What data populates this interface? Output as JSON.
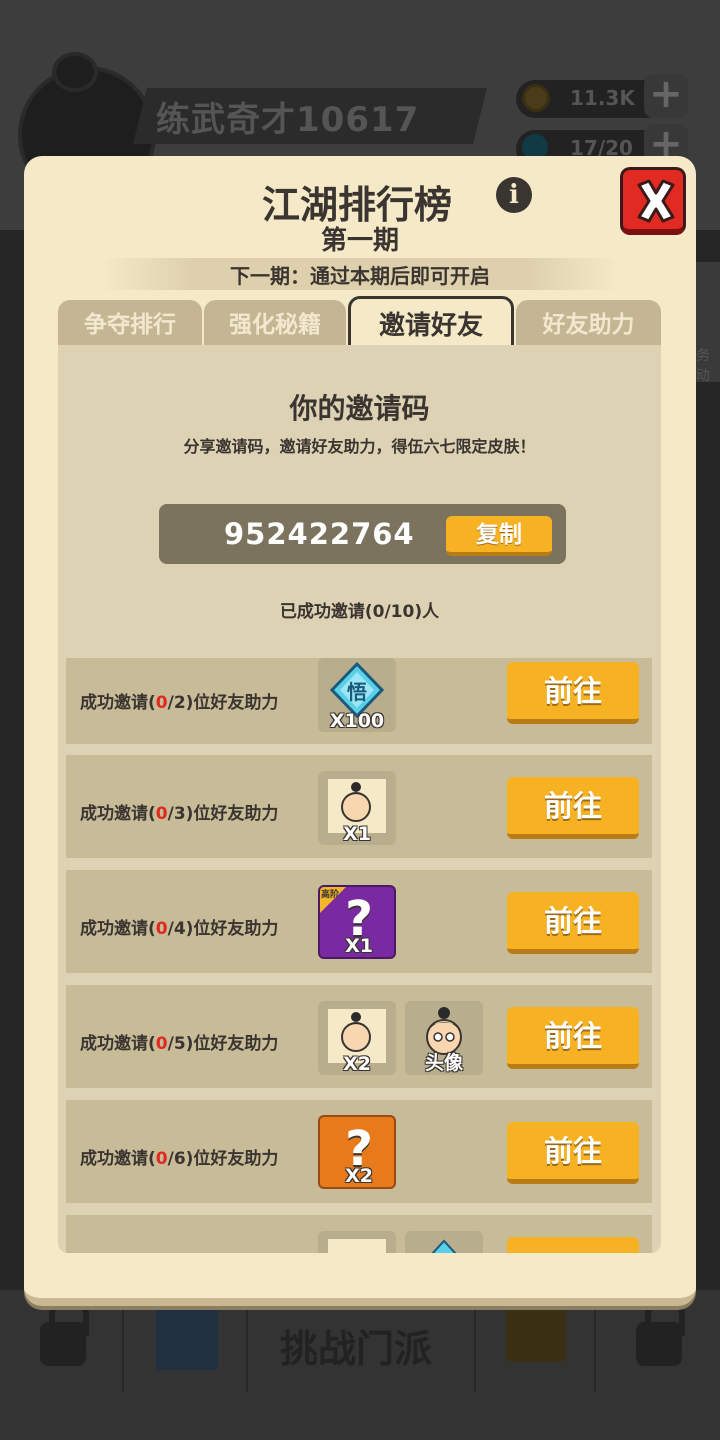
{
  "background": {
    "player_name": "练武奇才10617",
    "coins": "11.3K",
    "energy": "17/20",
    "side_button_text": "务\n动",
    "bottom_main_label": "挑战门派"
  },
  "modal": {
    "title": "江湖排行榜",
    "subtitle": "第一期",
    "next_period": "下一期：通过本期后即可开启",
    "tabs": [
      {
        "label": "争夺排行",
        "active": false
      },
      {
        "label": "强化秘籍",
        "active": false
      },
      {
        "label": "邀请好友",
        "active": true
      },
      {
        "label": "好友助力",
        "active": false
      }
    ]
  },
  "invite": {
    "heading": "你的邀请码",
    "description": "分享邀请码，邀请好友助力，得伍六七限定皮肤！",
    "code": "952422764",
    "copy_label": "复制",
    "success_count": "已成功邀请(0/10)人",
    "rows": [
      {
        "prefix": "成功邀请(",
        "done": "0",
        "total": "/2)位好友助力",
        "go_label": "前往",
        "rewards": [
          {
            "icon": "diamond-gem-icon",
            "glyph": "悟",
            "qty": "X100"
          }
        ]
      },
      {
        "prefix": "成功邀请(",
        "done": "0",
        "total": "/3)位好友助力",
        "go_label": "前往",
        "rewards": [
          {
            "icon": "character-portrait-icon",
            "qty": "X1"
          }
        ]
      },
      {
        "prefix": "成功邀请(",
        "done": "0",
        "total": "/4)位好友助力",
        "go_label": "前往",
        "rewards": [
          {
            "icon": "mystery-box-icon",
            "tier": "高阶",
            "qty": "X1"
          }
        ]
      },
      {
        "prefix": "成功邀请(",
        "done": "0",
        "total": "/5)位好友助力",
        "go_label": "前往",
        "rewards": [
          {
            "icon": "character-portrait-icon",
            "qty": "X2"
          },
          {
            "icon": "avatar-frame-icon",
            "qty": "头像"
          }
        ]
      },
      {
        "prefix": "成功邀请(",
        "done": "0",
        "total": "/6)位好友助力",
        "go_label": "前往",
        "rewards": [
          {
            "icon": "mystery-shirt-icon",
            "qty": "X2"
          }
        ]
      }
    ]
  }
}
